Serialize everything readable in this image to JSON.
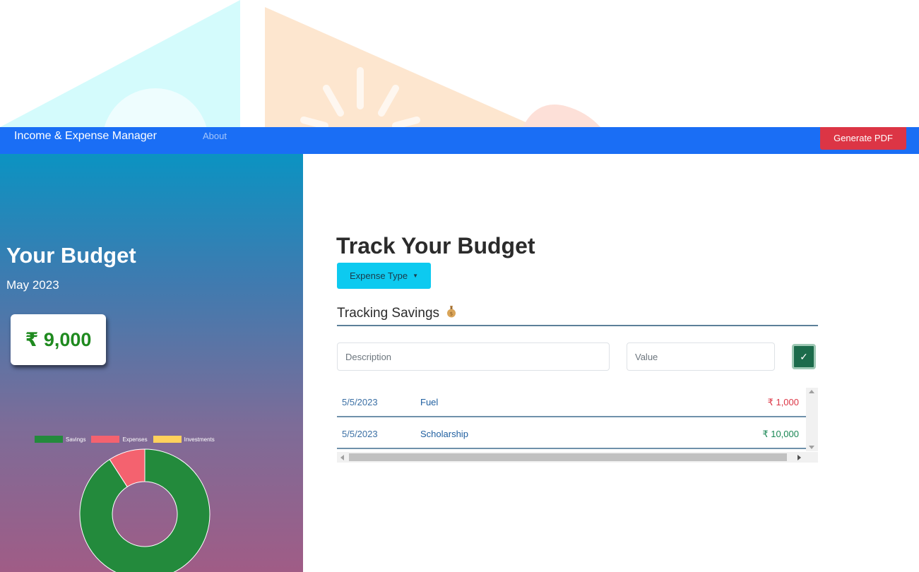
{
  "navbar": {
    "brand": "Income & Expense Manager",
    "about_link": "About",
    "generate_pdf": "Generate PDF",
    "color": "#1a6ef5"
  },
  "sidebar": {
    "title": "Your Budget",
    "month": "May 2023",
    "balance": "₹ 9,000"
  },
  "chart_data": {
    "type": "pie",
    "variant": "doughnut",
    "legend_position": "top",
    "series": [
      {
        "name": "Savings",
        "value": 10000,
        "color": "#238a3c"
      },
      {
        "name": "Expenses",
        "value": 1000,
        "color": "#f4626f"
      },
      {
        "name": "Investments",
        "value": 0,
        "color": "#ffd15c"
      }
    ]
  },
  "main": {
    "title": "Track Your Budget",
    "dropdown_label": "Expense Type",
    "section_title": "Tracking Savings",
    "section_icon": "money-bag-icon",
    "description_placeholder": "Description",
    "value_placeholder": "Value",
    "submit_icon": "✓"
  },
  "transactions": [
    {
      "date": "5/5/2023",
      "description": "Fuel",
      "amount": "₹ 1,000",
      "type": "expense"
    },
    {
      "date": "5/5/2023",
      "description": "Scholarship",
      "amount": "₹ 10,000",
      "type": "income"
    }
  ],
  "colors": {
    "expense": "#dc3545",
    "income": "#198754",
    "danger_button": "#dc3545",
    "info_button": "#0dcaf0",
    "success_button": "#1c6b4b"
  }
}
